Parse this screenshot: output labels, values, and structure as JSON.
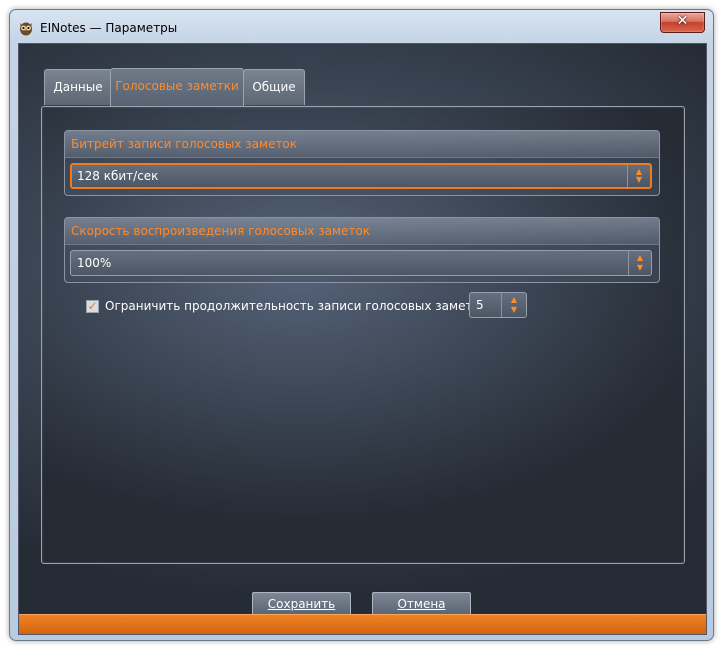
{
  "window": {
    "title": "EINotes — Параметры",
    "close_label": "✕"
  },
  "tabs": [
    {
      "label": "Данные",
      "active": false
    },
    {
      "label": "Голосовые заметки",
      "active": true
    },
    {
      "label": "Общие",
      "active": false
    }
  ],
  "bitrate": {
    "header": "Битрейт записи голосовых заметок",
    "value": "128 кбит/сек"
  },
  "playback_speed": {
    "header": "Скорость воспроизведения голосовых заметок",
    "value": "100%"
  },
  "limit_duration": {
    "checked": true,
    "label": "Ограничить продолжительность записи голосовых заметок, мин.",
    "value": "5"
  },
  "buttons": {
    "save": "Сохранить",
    "cancel": "Отмена"
  },
  "colors": {
    "accent": "#f07a1c",
    "header_text": "#ff8a2c"
  },
  "icons": {
    "app": "owl-icon",
    "spin_up": "▲",
    "spin_down": "▼",
    "check": "✓"
  }
}
